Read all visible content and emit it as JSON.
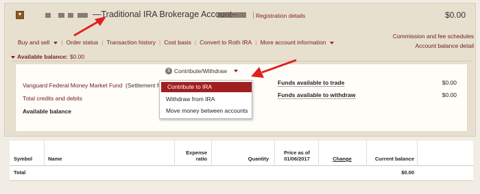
{
  "account": {
    "title": "—Traditional IRA Brokerage Account–",
    "registration_link": "Registration details",
    "total_balance": "$0.00"
  },
  "toolbar": [
    {
      "label": "Buy and sell",
      "has_caret": true
    },
    {
      "label": "Order status"
    },
    {
      "label": "Transaction history"
    },
    {
      "label": "Cost basis"
    },
    {
      "label": "Convert to Roth IRA"
    },
    {
      "label": "More account information",
      "has_caret": true
    }
  ],
  "right_links": {
    "commission": "Commission and fee schedules",
    "balance_detail": "Account balance detail"
  },
  "available_balance": {
    "header_label": "Available balance:",
    "header_value": "$0.00",
    "contribute_withdraw": "Contribute/Withdraw",
    "fund_name": "Vanguard Federal Money Market Fund",
    "settlement": "(Settlement fu",
    "total_credits": "Total credits and debits",
    "available_label": "Available balance",
    "funds_trade_label": "Funds available to trade",
    "funds_trade_value": "$0.00",
    "funds_withdraw_label": "Funds available to withdraw",
    "funds_withdraw_value": "$0.00"
  },
  "dropdown_menu": [
    {
      "label": "Contribute to IRA",
      "selected": true
    },
    {
      "label": "Withdraw from IRA"
    },
    {
      "label": "Move money between accounts"
    }
  ],
  "holdings_table": {
    "headers": {
      "symbol": "Symbol",
      "name": "Name",
      "expense_1": "Expense",
      "expense_2": "ratio",
      "quantity": "Quantity",
      "price_1": "Price as of",
      "price_2": "01/06/2017",
      "change": "Change",
      "current_balance": "Current balance"
    },
    "total_row": {
      "label": "Total",
      "current_balance": "$0.00"
    }
  },
  "colors": {
    "accent": "#a01f1f",
    "link": "#6b1a1a",
    "panel_bg": "#e7e0cf",
    "arrow": "#e02020"
  }
}
